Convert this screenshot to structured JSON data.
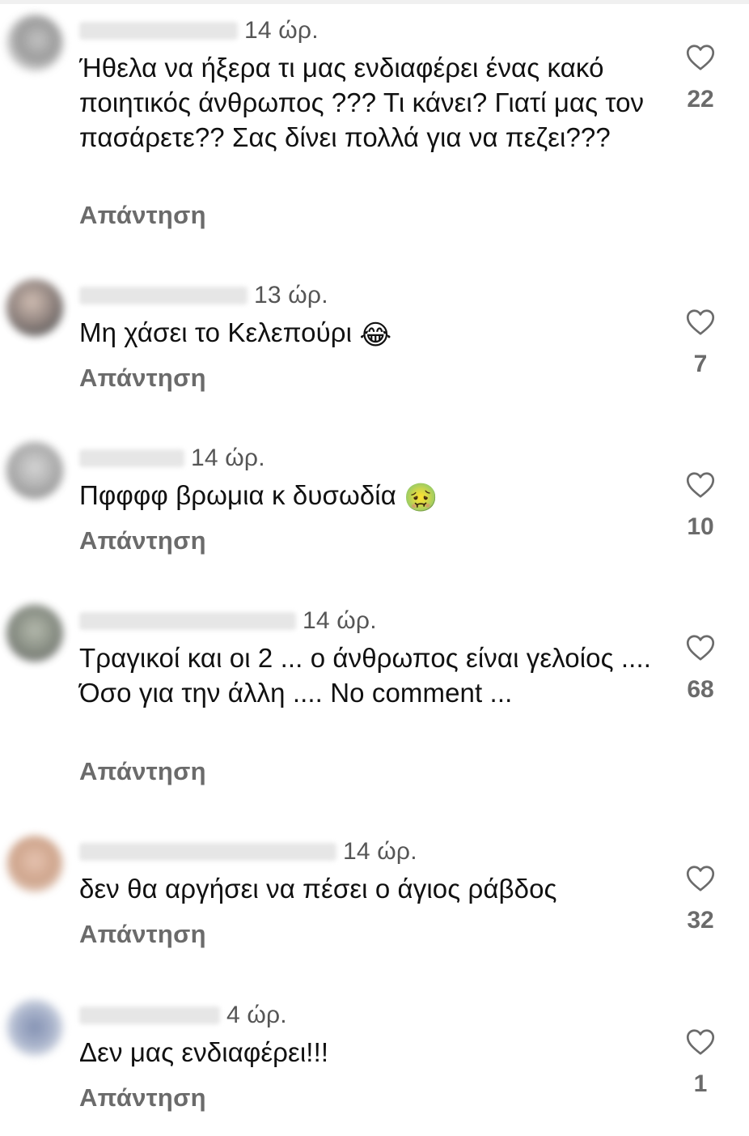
{
  "reply_label": "Απάντηση",
  "accent_color": "#6b6b6b",
  "comments": [
    {
      "username": "",
      "time": "14 ώρ.",
      "text": "Ήθελα να ήξερα τι μας ενδιαφέρει ένας κακό ποιητικός άνθρωπος ??? Τι κάνει? Γιατί μας τον πασάρετε?? Σας δίνει πολλά για να πεζει???",
      "likes": "22",
      "emoji": ""
    },
    {
      "username": "",
      "time": "13 ώρ.",
      "text": "Μη χάσει το Κελεπούρι",
      "likes": "7",
      "emoji": "😂"
    },
    {
      "username": "",
      "time": "14 ώρ.",
      "text": "Πφφφφ βρωμια κ δυσωδία",
      "likes": "10",
      "emoji": "🤢"
    },
    {
      "username": "",
      "time": "14 ώρ.",
      "text": "Τραγικοί και οι 2 ... ο άνθρωπος είναι γελοίος .... Όσο για την άλλη .... Νο comment ...",
      "likes": "68",
      "emoji": ""
    },
    {
      "username": "",
      "time": "14 ώρ.",
      "text": "δεν θα αργήσει να πέσει ο άγιος ράβδος",
      "likes": "32",
      "emoji": ""
    },
    {
      "username": "",
      "time": "4 ώρ.",
      "text": "Δεν μας ενδιαφέρει!!!",
      "likes": "1",
      "emoji": ""
    }
  ]
}
